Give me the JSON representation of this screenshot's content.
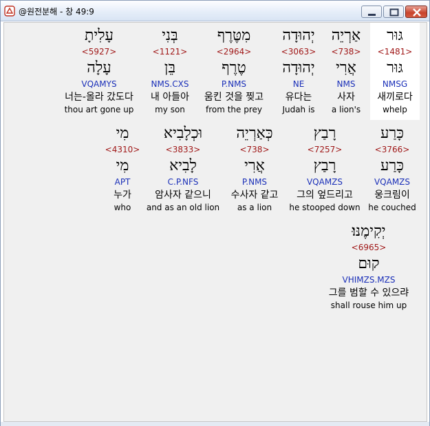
{
  "window": {
    "title": "@원전분해 - 창 49:9"
  },
  "rows": [
    {
      "words": [
        {
          "id": "w1481",
          "surface": "גּוּר",
          "strong": "<1481>",
          "lemma": "גּוּר",
          "parse": "NMSG",
          "korean": "새끼로다",
          "english": "whelp",
          "selected": true
        },
        {
          "id": "w738a",
          "surface": "אַרְיֵה",
          "strong": "<738>",
          "lemma": "אֲרִי",
          "parse": "NMS",
          "korean": "사자",
          "english": "a lion's"
        },
        {
          "id": "w3063",
          "surface": "יְהוּדָה",
          "strong": "<3063>",
          "lemma": "יְהוּדָה",
          "parse": "NE",
          "korean": "유다는",
          "english": "Judah is"
        },
        {
          "id": "w2964",
          "surface": "מִטֶּרֶף",
          "strong": "<2964>",
          "lemma": "טֶרֶף",
          "parse": "P.NMS",
          "korean": "움킨 것을 찢고",
          "english": "from the prey"
        },
        {
          "id": "w1121",
          "surface": "בְּנִי",
          "strong": "<1121>",
          "lemma": "בֵּן",
          "parse": "NMS.CXS",
          "korean": "내 아들아",
          "english": "my son"
        },
        {
          "id": "w5927",
          "surface": "עָלִיתָ",
          "strong": "<5927>",
          "lemma": "עָלָה",
          "parse": "VQAMYS",
          "korean": "너는-올라 갔도다",
          "english": "thou art gone up"
        }
      ]
    },
    {
      "words": [
        {
          "id": "w3766",
          "surface": "כָּרַע",
          "strong": "<3766>",
          "lemma": "כָּרַע",
          "parse": "VQAMZS",
          "korean": "웅크림이",
          "english": "he couched"
        },
        {
          "id": "w7257",
          "surface": "רָבַץ",
          "strong": "<7257>",
          "lemma": "רָבַץ",
          "parse": "VQAMZS",
          "korean": "그의 엎드리고",
          "english": "he stooped down"
        },
        {
          "id": "w738b",
          "surface": "כְּאַרְיֵה",
          "strong": "<738>",
          "lemma": "אֲרִי",
          "parse": "P.NMS",
          "korean": "수사자 같고",
          "english": "as a lion"
        },
        {
          "id": "w3833",
          "surface": "וּכְלָבִיא",
          "strong": "<3833>",
          "lemma": "לָבִיא",
          "parse": "C.P.NFS",
          "korean": "암사자 같으니",
          "english": "and as an old lion"
        },
        {
          "id": "w4310",
          "surface": "מִי",
          "strong": "<4310>",
          "lemma": "מִי",
          "parse": "APT",
          "korean": "누가",
          "english": "who"
        }
      ]
    },
    {
      "words": [
        {
          "id": "w6965",
          "surface": "יְקִימֶנּוּ׃",
          "strong": "<6965>",
          "lemma": "קוּם",
          "parse": "VHIMZS.MZS",
          "korean": "그를 범할 수 있으랴",
          "english": "shall rouse him up"
        }
      ]
    }
  ]
}
